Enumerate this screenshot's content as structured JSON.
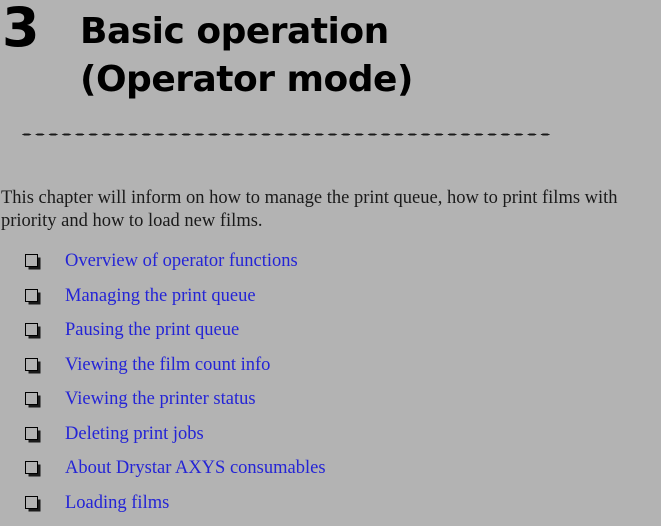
{
  "page": {
    "background_color": "#b3b3b3",
    "text_color": "#1a1a1a",
    "link_color": "#2424d6"
  },
  "chapter": {
    "number": "3",
    "title_line_1": "Basic operation",
    "title_line_2": "(Operator mode)"
  },
  "intro": {
    "paragraph": "This chapter will inform on how to manage the print queue, how to print films with priority and how to load new films."
  },
  "toc": {
    "bullet_glyph": "checkbox-shadow-square",
    "items": [
      {
        "label": "Overview of operator functions"
      },
      {
        "label": "Managing the print queue"
      },
      {
        "label": "Pausing the print queue"
      },
      {
        "label": "Viewing the film count info"
      },
      {
        "label": "Viewing the printer status"
      },
      {
        "label": "Deleting print jobs"
      },
      {
        "label": "About Drystar AXYS consumables"
      },
      {
        "label": "Loading films"
      }
    ]
  }
}
